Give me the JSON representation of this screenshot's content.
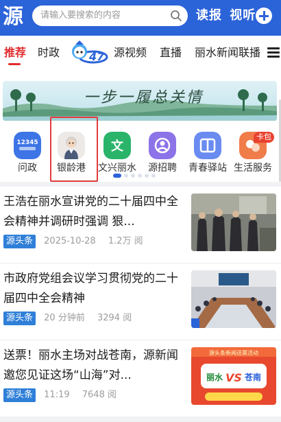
{
  "header": {
    "logo": "源",
    "search_placeholder": "请输入要搜索的内容",
    "link_read": "读报",
    "link_watch": "视听"
  },
  "tabs": [
    {
      "label": "推荐",
      "active": true
    },
    {
      "label": "时政",
      "active": false
    },
    {
      "label": "源视频",
      "active": false
    },
    {
      "label": "直播",
      "active": false
    },
    {
      "label": "丽水新闻联播",
      "active": false
    }
  ],
  "banner": {
    "text": "一步一履总关情"
  },
  "grid": {
    "items": [
      {
        "label": "问政",
        "icon": "12345-icon",
        "color": "#3d74e6"
      },
      {
        "label": "银龄港",
        "icon": "elderly-avatar-icon",
        "color": "#b9b6b3"
      },
      {
        "label": "文兴丽水",
        "icon": "culture-icon",
        "color": "#29b46a"
      },
      {
        "label": "源招聘",
        "icon": "recruit-icon",
        "color": "#8d73e8"
      },
      {
        "label": "青春驿站",
        "icon": "book-icon",
        "color": "#6a8cf0"
      },
      {
        "label": "生活服务",
        "icon": "service-icon",
        "color": "#f07c4a"
      }
    ],
    "badge": "卡包",
    "page_count": 6,
    "active_page": 0
  },
  "news": [
    {
      "title": "王浩在丽水宣讲党的二十届四中全会精神并调研时强调 狠...",
      "source": "源头条",
      "time": "2025-10-28",
      "views": "1.2万 阅"
    },
    {
      "title": "市政府党组会议学习贯彻党的二十届四中全会精神",
      "source": "源头条",
      "time": "20 分钟前",
      "views": "3294 阅"
    },
    {
      "title": "送票！丽水主场对战苍南，源新闻邀您见证这场“山海”对...",
      "source": "源头条",
      "time": "11:19",
      "views": "7648 阅"
    }
  ],
  "thumb3": {
    "line1": "丽水",
    "vs": "VS",
    "line2": "苍南",
    "top": "源头条新闻送票活动"
  },
  "colors": {
    "brand": "#2b63d9",
    "accent": "#e12c2c",
    "tag": "#2f7fd8"
  }
}
